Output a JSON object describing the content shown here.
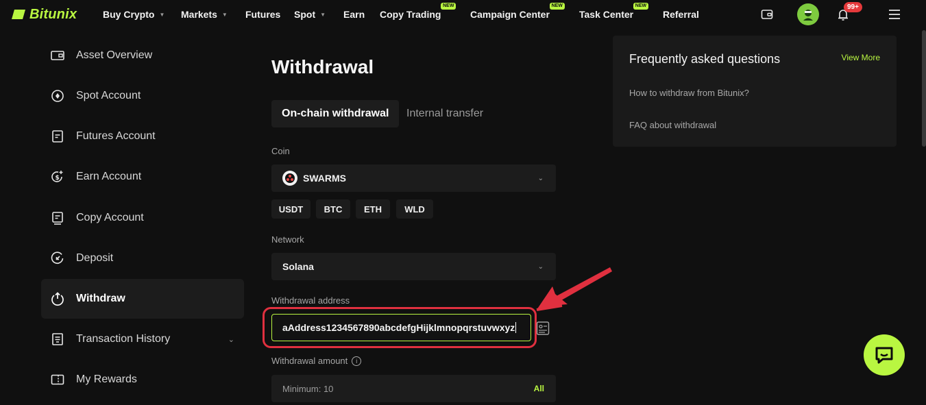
{
  "brand": {
    "name": "Bitunix",
    "accent": "#b9f641"
  },
  "nav": {
    "items": [
      {
        "label": "Buy Crypto",
        "dropdown": true
      },
      {
        "label": "Markets",
        "dropdown": true
      },
      {
        "label": "Futures",
        "dropdown": false
      },
      {
        "label": "Spot",
        "dropdown": true
      },
      {
        "label": "Earn",
        "dropdown": false
      },
      {
        "label": "Copy Trading",
        "dropdown": false,
        "badge": "NEW"
      },
      {
        "label": "Campaign Center",
        "dropdown": false,
        "badge": "NEW"
      },
      {
        "label": "Task Center",
        "dropdown": false,
        "badge": "NEW"
      },
      {
        "label": "Referral",
        "dropdown": false
      }
    ],
    "notification_count": "99+",
    "icons": [
      "wallet-icon",
      "avatar",
      "bell-icon",
      "menu-icon"
    ]
  },
  "sidebar": {
    "items": [
      {
        "label": "Asset Overview",
        "icon": "wallet-icon",
        "active": false
      },
      {
        "label": "Spot Account",
        "icon": "target-icon",
        "active": false
      },
      {
        "label": "Futures Account",
        "icon": "document-icon",
        "active": false
      },
      {
        "label": "Earn Account",
        "icon": "dollar-plus-icon",
        "active": false
      },
      {
        "label": "Copy Account",
        "icon": "copy-icon",
        "active": false
      },
      {
        "label": "Deposit",
        "icon": "deposit-icon",
        "active": false
      },
      {
        "label": "Withdraw",
        "icon": "withdraw-icon",
        "active": true
      },
      {
        "label": "Transaction History",
        "icon": "history-icon",
        "active": false,
        "expandable": true
      },
      {
        "label": "My Rewards",
        "icon": "rewards-icon",
        "active": false
      }
    ]
  },
  "main": {
    "title": "Withdrawal",
    "tabs": [
      {
        "label": "On-chain withdrawal",
        "active": true
      },
      {
        "label": "Internal transfer",
        "active": false
      }
    ],
    "coin": {
      "label": "Coin",
      "selected": "SWARMS",
      "quick_picks": [
        "USDT",
        "BTC",
        "ETH",
        "WLD"
      ]
    },
    "network": {
      "label": "Network",
      "selected": "Solana"
    },
    "address": {
      "label": "Withdrawal address",
      "value": "aAddress1234567890abcdefgHijklmnopqrstuvwxyz"
    },
    "amount": {
      "label": "Withdrawal amount",
      "placeholder": "Minimum: 10",
      "all_label": "All"
    }
  },
  "faq": {
    "title": "Frequently asked questions",
    "view_more": "View More",
    "links": [
      "How to withdraw from Bitunix?",
      "FAQ about withdrawal"
    ]
  },
  "annotation": {
    "highlight_color": "#e0303f"
  }
}
